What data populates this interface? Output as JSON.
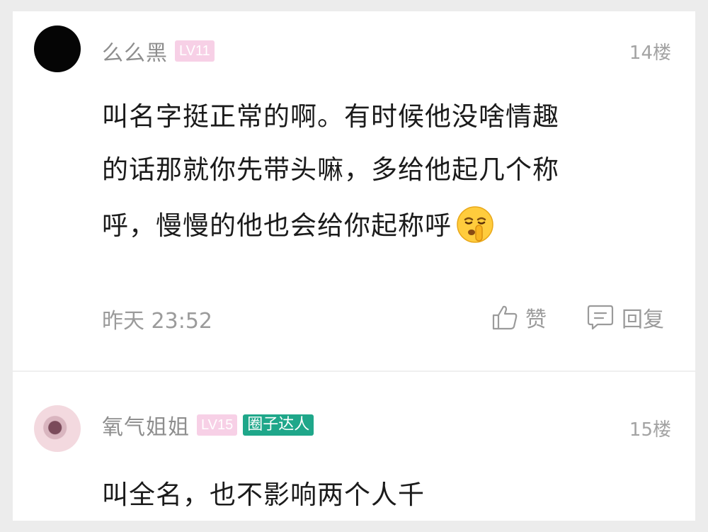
{
  "comments": [
    {
      "username": "么么黑",
      "level": "LV11",
      "floor": "14楼",
      "text_lines": [
        "叫名字挺正常的啊。有时候他没啥情趣",
        "的话那就你先带头嘛，多给他起几个称",
        "呼，慢慢的他也会给你起称呼"
      ],
      "time": "昨天 23:52",
      "like_label": "赞",
      "reply_label": "回复"
    },
    {
      "username": "氧气姐姐",
      "level": "LV15",
      "badge": "圈子达人",
      "floor": "15楼",
      "text_lines": [
        "叫全名，也不影响两个人千"
      ]
    }
  ]
}
